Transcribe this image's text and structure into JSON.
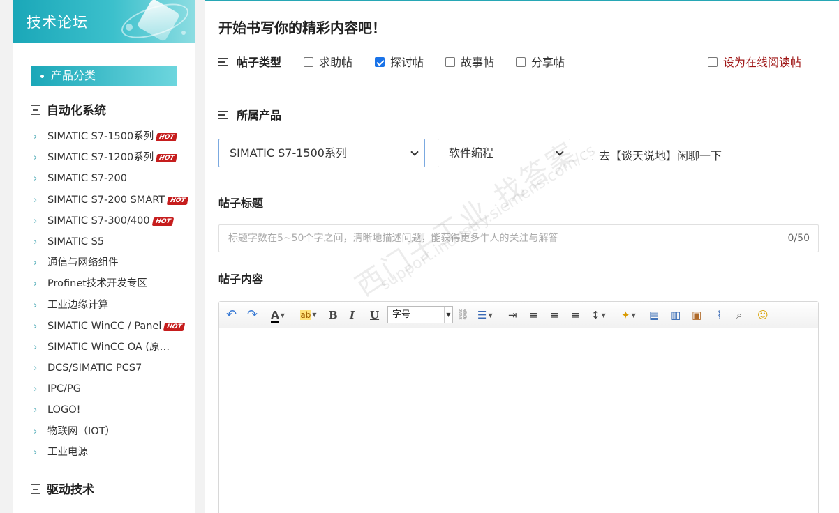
{
  "sidebar": {
    "header_title": "技术论坛",
    "category_pill": "产品分类",
    "groups": [
      {
        "title": "自动化系统"
      },
      {
        "title": "驱动技术"
      }
    ],
    "items": [
      {
        "label": "SIMATIC S7-1500系列",
        "hot": true
      },
      {
        "label": "SIMATIC S7-1200系列",
        "hot": true
      },
      {
        "label": "SIMATIC S7-200",
        "hot": false
      },
      {
        "label": "SIMATIC S7-200 SMART",
        "hot": true
      },
      {
        "label": "SIMATIC S7-300/400",
        "hot": true
      },
      {
        "label": "SIMATIC S5",
        "hot": false
      },
      {
        "label": "通信与网络组件",
        "hot": false
      },
      {
        "label": "Profinet技术开发专区",
        "hot": false
      },
      {
        "label": "工业边缘计算",
        "hot": false
      },
      {
        "label": "SIMATIC WinCC / Panel",
        "hot": true
      },
      {
        "label": "SIMATIC WinCC OA (原…",
        "hot": false
      },
      {
        "label": "DCS/SIMATIC PCS7",
        "hot": false
      },
      {
        "label": "IPC/PG",
        "hot": false
      },
      {
        "label": "LOGO!",
        "hot": false
      },
      {
        "label": "物联网（IOT）",
        "hot": false
      },
      {
        "label": "工业电源",
        "hot": false
      }
    ],
    "hot_badge": "HOT"
  },
  "main": {
    "page_title": "开始书写你的精彩内容吧！",
    "post_type": {
      "label": "帖子类型",
      "options": [
        {
          "label": "求助帖",
          "checked": false
        },
        {
          "label": "探讨帖",
          "checked": true
        },
        {
          "label": "故事帖",
          "checked": false
        },
        {
          "label": "分享帖",
          "checked": false
        }
      ],
      "online_read": {
        "label": "设为在线阅读帖",
        "checked": false
      }
    },
    "product": {
      "label": "所属产品",
      "select1": "SIMATIC S7-1500系列",
      "select2": "软件编程",
      "chat_option": "去【谈天说地】闲聊一下"
    },
    "title_section": {
      "label": "帖子标题",
      "placeholder": "标题字数在5~50个字之间，清晰地描述问题，能获得更多牛人的关注与解答",
      "counter": "0/50"
    },
    "content_section": {
      "label": "帖子内容",
      "font_size_select": "字号",
      "toolbar_icons": [
        "undo-icon",
        "redo-icon",
        "font-color-icon",
        "highlight-icon",
        "bold-icon",
        "italic-icon",
        "underline-icon",
        "link-icon",
        "list-icon",
        "indent-icon",
        "align-left-icon",
        "align-right-icon",
        "align-justify-icon",
        "line-height-icon",
        "magic-wand-icon",
        "insert-table-icon",
        "insert-block-icon",
        "image-icon",
        "attachment-icon",
        "search-replace-icon",
        "emoji-icon"
      ]
    }
  },
  "watermark": {
    "line1": "西门子工业 找答案",
    "line2": "support.industry.siemens.com/cs"
  },
  "colors": {
    "accent": "#1aa7b8",
    "checkbox_checked": "#1a73e8",
    "hot_badge": "#c61d1d",
    "online_read": "#a01818"
  }
}
